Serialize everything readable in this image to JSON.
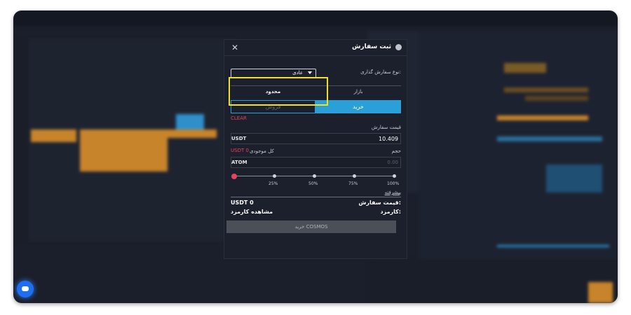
{
  "modal": {
    "title": "ثبت سفارش",
    "order_type_label": "نوع سفارش گذاری:",
    "order_type_value": "عادی",
    "tabs": {
      "market": "بازار",
      "limit": "محدود"
    },
    "side": {
      "buy": "خرید",
      "sell": "فروش"
    },
    "clear": "CLEAR",
    "price_label": "قیمت سفارش",
    "price_unit": "USDT",
    "price_value": "10.409",
    "volume_label": "حجم",
    "available_label": "کل موجودی",
    "available_value": "USDT 0",
    "volume_unit": "ATOM",
    "volume_placeholder": "0.00",
    "slider_marks": [
      "25%",
      "50%",
      "75%",
      "100%"
    ],
    "advanced_link": "پیشرفته",
    "order_total_label": "قیمت سفارش:",
    "order_total_value": "USDT 0",
    "fee_label": "کارمزد:",
    "fee_value": "مشاهده کارمزد",
    "submit_label": "خرید COSMOS"
  },
  "colors": {
    "accent": "#2a9fd8",
    "danger": "#e8425c",
    "highlight": "#f2e21c",
    "chart_orange": "#c8842a"
  }
}
